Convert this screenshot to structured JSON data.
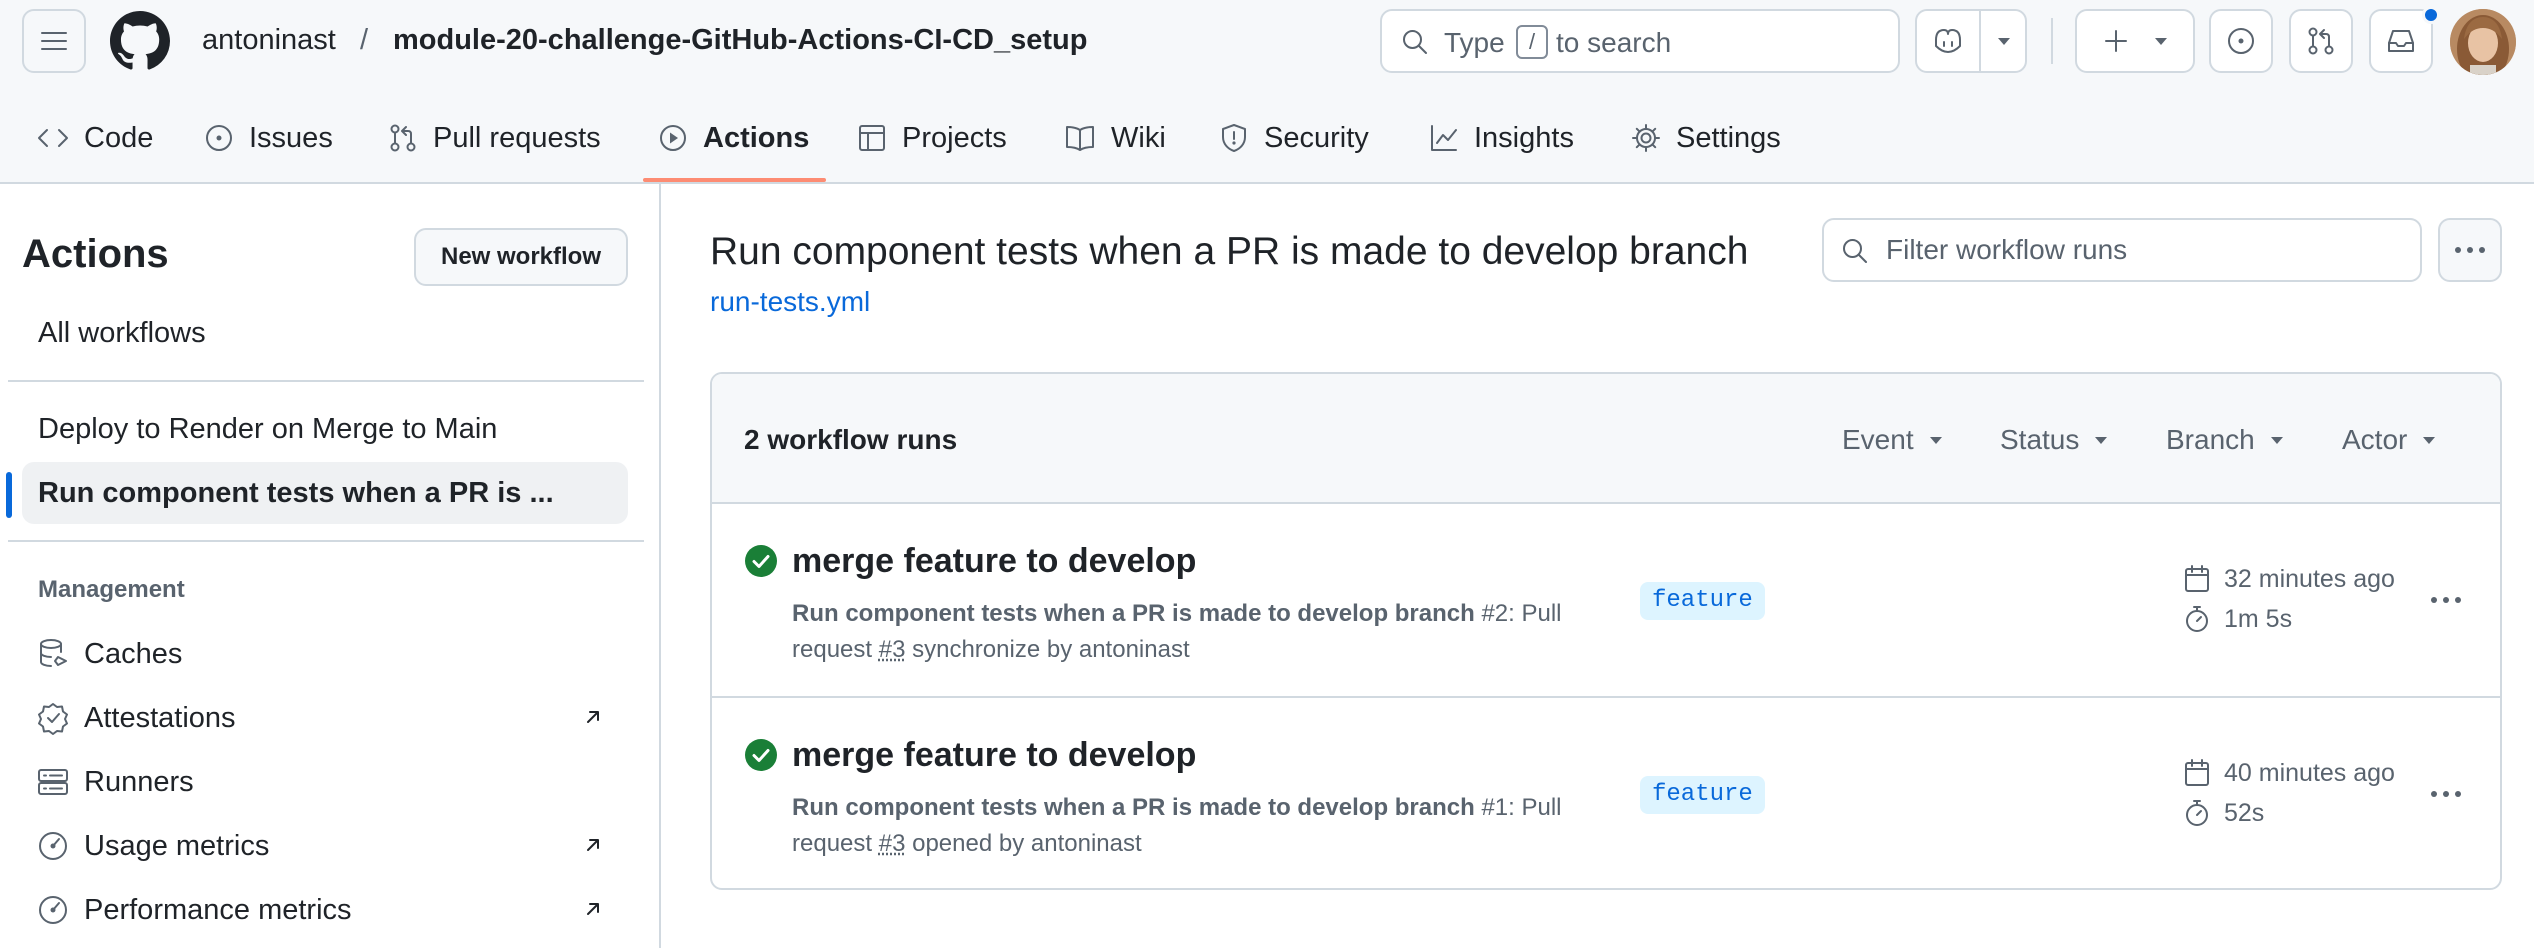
{
  "header": {
    "owner": "antoninast",
    "separator": "/",
    "repo": "module-20-challenge-GitHub-Actions-CI-CD_setup",
    "search": {
      "prefix": "Type",
      "key": "/",
      "suffix": "to search"
    }
  },
  "repo_nav": {
    "tabs": [
      {
        "label": "Code",
        "icon": "code-icon"
      },
      {
        "label": "Issues",
        "icon": "issue-icon"
      },
      {
        "label": "Pull requests",
        "icon": "pull-request-icon"
      },
      {
        "label": "Actions",
        "icon": "play-icon",
        "selected": true
      },
      {
        "label": "Projects",
        "icon": "table-icon"
      },
      {
        "label": "Wiki",
        "icon": "book-icon"
      },
      {
        "label": "Security",
        "icon": "shield-icon"
      },
      {
        "label": "Insights",
        "icon": "graph-icon"
      },
      {
        "label": "Settings",
        "icon": "gear-icon"
      }
    ],
    "accent": "#fd8c73"
  },
  "sidebar": {
    "title": "Actions",
    "new_workflow": "New workflow",
    "all_workflows": "All workflows",
    "workflows": [
      {
        "label": "Deploy to Render on Merge to Main"
      },
      {
        "label": "Run component tests when a PR is ...",
        "active": true
      }
    ],
    "management_label": "Management",
    "management": [
      {
        "label": "Caches",
        "icon": "database-icon",
        "external": false
      },
      {
        "label": "Attestations",
        "icon": "verified-icon",
        "external": true
      },
      {
        "label": "Runners",
        "icon": "server-icon",
        "external": false
      },
      {
        "label": "Usage metrics",
        "icon": "meter-icon",
        "external": true
      },
      {
        "label": "Performance metrics",
        "icon": "meter-icon",
        "external": true
      }
    ]
  },
  "main": {
    "title": "Run component tests when a PR is made to develop branch",
    "file": "run-tests.yml",
    "filter_placeholder": "Filter workflow runs",
    "runs_count": "2 workflow runs",
    "filters": [
      "Event",
      "Status",
      "Branch",
      "Actor"
    ],
    "runs": [
      {
        "title": "merge feature to develop",
        "workflow": "Run component tests when a PR is made to develop branch",
        "run_number": "#2",
        "desc_pre": ": Pull request",
        "pr": "#3",
        "desc_post": "synchronize by antoninast",
        "branch": "feature",
        "time": "32 minutes ago",
        "duration": "1m 5s",
        "status": "success"
      },
      {
        "title": "merge feature to develop",
        "workflow": "Run component tests when a PR is made to develop branch",
        "run_number": "#1",
        "desc_pre": ": Pull request",
        "pr": "#3",
        "desc_post": "opened by antoninast",
        "branch": "feature",
        "time": "40 minutes ago",
        "duration": "52s",
        "status": "success"
      }
    ]
  },
  "colors": {
    "link": "#0969da",
    "success": "#1a7f37",
    "border": "#d1d9e0",
    "muted": "#59636e"
  }
}
